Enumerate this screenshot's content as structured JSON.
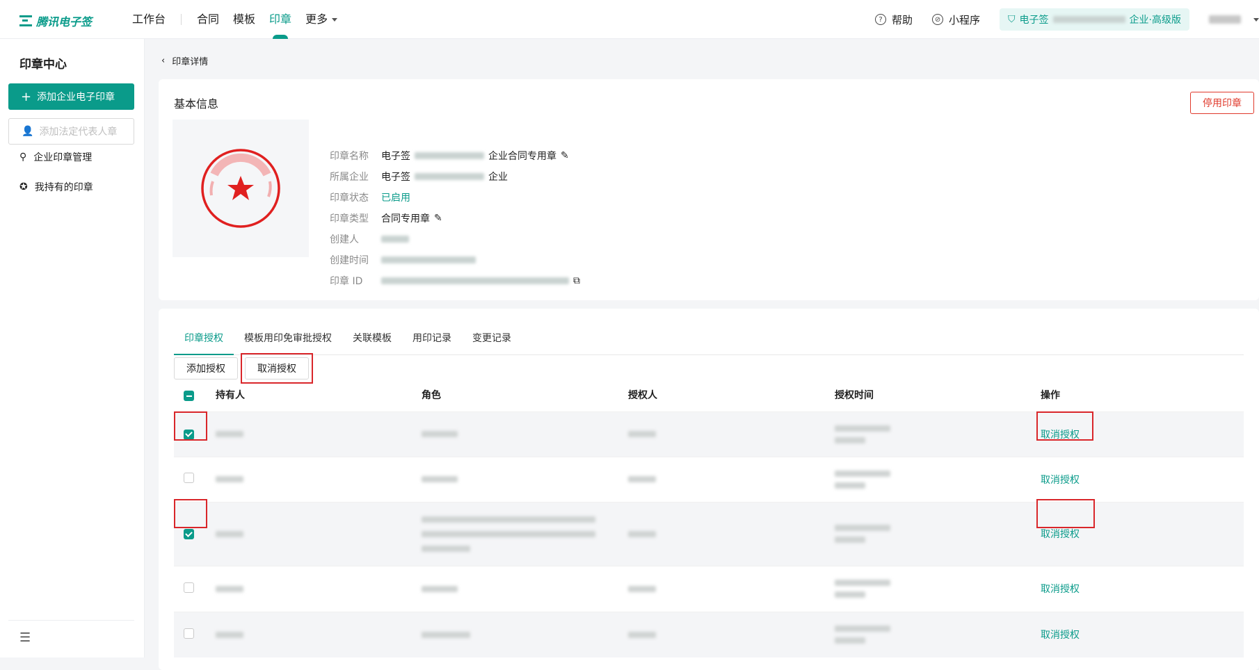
{
  "app": {
    "logo_text": "腾讯电子签"
  },
  "topnav": {
    "items": [
      "工作台",
      "合同",
      "模板",
      "印章",
      "更多"
    ],
    "active": "印章"
  },
  "topright": {
    "help": "帮助",
    "mini": "小程序",
    "org_prefix": "电子签",
    "org_suffix": "企业·高级版"
  },
  "sidebar": {
    "title": "印章中心",
    "add_btn": "添加企业电子印章",
    "add_legal_btn": "添加法定代表人章",
    "items": [
      "企业印章管理",
      "我持有的印章"
    ]
  },
  "breadcrumb": {
    "label": "印章详情"
  },
  "basic": {
    "title": "基本信息",
    "disable_btn": "停用印章",
    "rows": [
      {
        "label": "印章名称",
        "value_prefix": "电子签",
        "value_suffix": "企业合同专用章"
      },
      {
        "label": "所属企业",
        "value_prefix": "电子签",
        "value_suffix": "企业"
      },
      {
        "label": "印章状态",
        "value": "已启用"
      },
      {
        "label": "印章类型",
        "value": "合同专用章"
      },
      {
        "label": "创建人"
      },
      {
        "label": "创建时间"
      },
      {
        "label": "印章 ID"
      }
    ]
  },
  "tabs": [
    "印章授权",
    "模板用印免审批授权",
    "关联模板",
    "用印记录",
    "变更记录"
  ],
  "actions": {
    "add": "添加授权",
    "revoke": "取消授权"
  },
  "table": {
    "headers": [
      "持有人",
      "角色",
      "授权人",
      "授权时间",
      "操作"
    ],
    "rows": [
      {
        "checked": true,
        "action": "取消授权"
      },
      {
        "checked": false,
        "action": "取消授权"
      },
      {
        "checked": true,
        "action": "取消授权"
      },
      {
        "checked": false,
        "action": "取消授权"
      },
      {
        "checked": false,
        "action": "取消授权"
      }
    ]
  },
  "colors": {
    "accent": "#0a9b8a",
    "danger": "#e0392b",
    "highlight": "#d9262a"
  }
}
